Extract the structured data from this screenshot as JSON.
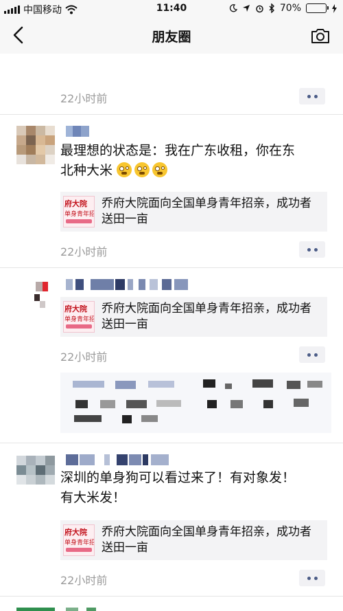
{
  "status_bar": {
    "carrier": "中国移动",
    "time": "11:40",
    "battery": "70%",
    "battery_level": 0.7,
    "battery_color": "#4cd964"
  },
  "nav": {
    "title": "朋友圈",
    "back_icon": "chevron-left-icon",
    "camera_icon": "camera-icon"
  },
  "feed": {
    "top_post": {
      "time": "22小时前"
    },
    "posts": [
      {
        "text_line1": "最理想的状态是：我在广东收租，你在东",
        "text_line2": "北种大米",
        "emoji": "flushed-face-icon",
        "link": {
          "thumb_title": "府大院",
          "thumb_sub": "单身青年招亲",
          "title": "乔府大院面向全国单身青年招亲，成功者送田一亩"
        },
        "time": "22小时前"
      },
      {
        "link": {
          "thumb_title": "府大院",
          "thumb_sub": "单身青年招亲",
          "title": "乔府大院面向全国单身青年招亲，成功者送田一亩"
        },
        "time": "22小时前"
      },
      {
        "text_line1": "深圳的单身狗可以看过来了！有对象发！",
        "text_line2": "有大米发！",
        "link": {
          "thumb_title": "府大院",
          "thumb_sub": "单身青年招亲",
          "title": "乔府大院面向全国单身青年招亲，成功者送田一亩"
        },
        "time": "22小时前"
      }
    ]
  },
  "colors": {
    "accent": "#4a5b86",
    "meta_text": "#9a9a9a",
    "card_bg": "#f3f3f5"
  }
}
